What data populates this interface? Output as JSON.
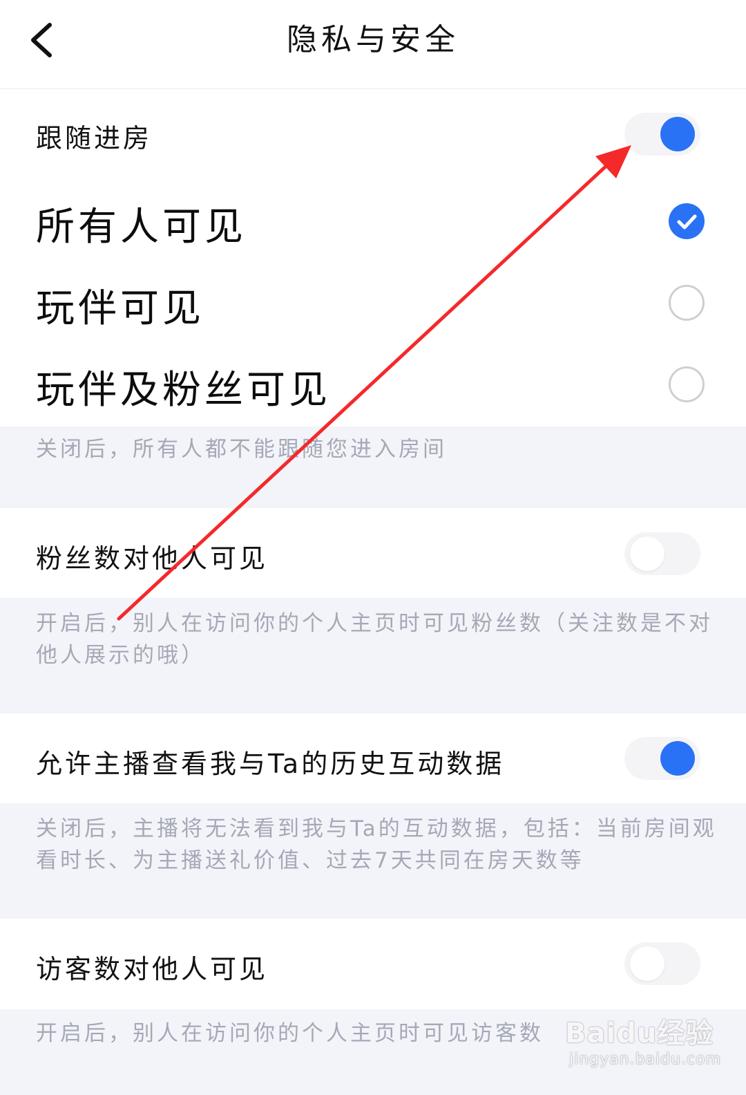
{
  "header": {
    "title": "隐私与安全",
    "back_icon": "chevron-left-icon"
  },
  "follow_room": {
    "label": "跟随进房",
    "toggle_on": true,
    "options": [
      {
        "label": "所有人可见",
        "selected": true
      },
      {
        "label": "玩伴可见",
        "selected": false
      },
      {
        "label": "玩伴及粉丝可见",
        "selected": false
      }
    ],
    "description": "关闭后，所有人都不能跟随您进入房间"
  },
  "fans_visible": {
    "label": "粉丝数对他人可见",
    "toggle_on": false,
    "description": "开启后，别人在访问你的个人主页时可见粉丝数（关注数是不对他人展示的哦）"
  },
  "history_interaction": {
    "label": "允许主播查看我与Ta的历史互动数据",
    "toggle_on": true,
    "description": "关闭后，主播将无法看到我与Ta的互动数据，包括：当前房间观看时长、为主播送礼价值、过去7天共同在房天数等"
  },
  "visitors_visible": {
    "label": "访客数对他人可见",
    "toggle_on": false,
    "description": "开启后，别人在访问你的个人主页时可见访客数"
  },
  "watermark": {
    "main": "Baidu经验",
    "url": "jingyan.baidu.com"
  },
  "colors": {
    "accent": "#2a72f5",
    "annotation_arrow": "#f4292b",
    "section_bg": "#f3f4f9",
    "description_text": "#a5a8b6"
  }
}
